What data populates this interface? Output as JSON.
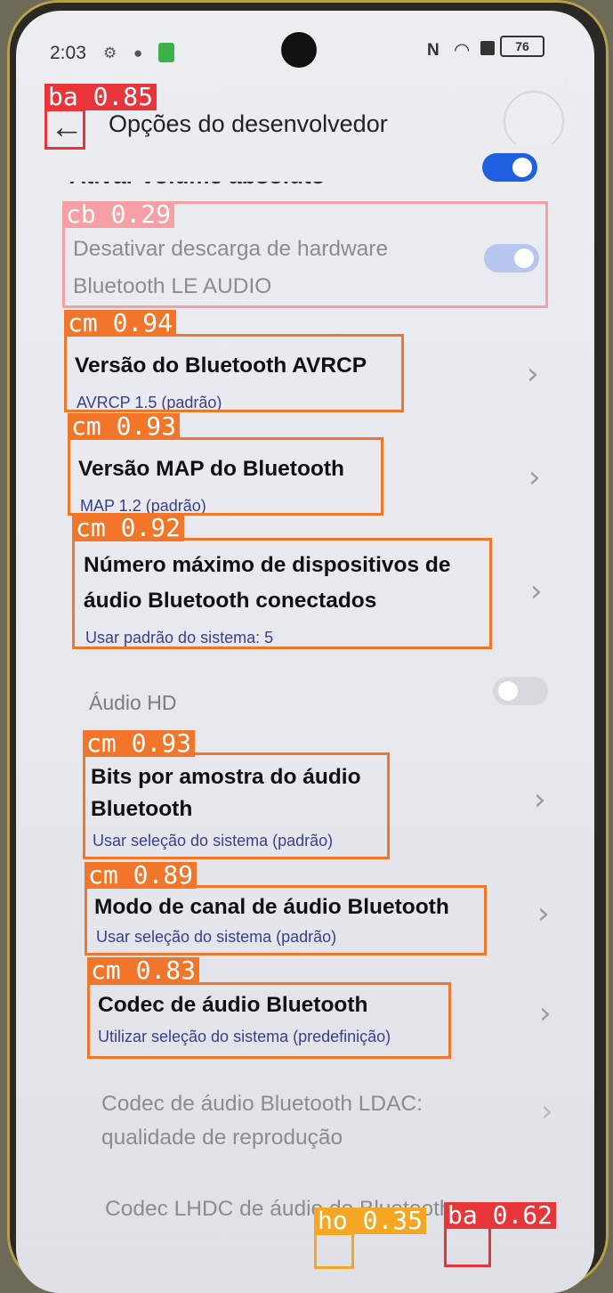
{
  "status_bar": {
    "time": "2:03",
    "battery": "76",
    "nfc_label": "N"
  },
  "header": {
    "title": "Opções do desenvolvedor"
  },
  "settings": {
    "cut_item_title": "Ativar volume absoluto",
    "disable_offload_line1": "Desativar descarga de hardware",
    "disable_offload_line2": "Bluetooth LE AUDIO",
    "avrcp_title": "Versão do Bluetooth AVRCP",
    "avrcp_value": "AVRCP 1.5 (padrão)",
    "map_title": "Versão MAP do Bluetooth",
    "map_value": "MAP 1.2 (padrão)",
    "max_devices_line1": "Número máximo de dispositivos de",
    "max_devices_line2": "áudio Bluetooth conectados",
    "max_devices_value": "Usar padrão do sistema: 5",
    "hd_audio_header": "Áudio HD",
    "bits_line1": "Bits por amostra do áudio",
    "bits_line2": "Bluetooth",
    "bits_value": "Usar seleção do sistema (padrão)",
    "channel_title": "Modo de canal de áudio Bluetooth",
    "channel_value": "Usar seleção do sistema (padrão)",
    "codec_title": "Codec de áudio Bluetooth",
    "codec_value": "Utilizar seleção do sistema (predefinição)",
    "ldac_line1": "Codec de áudio Bluetooth LDAC:",
    "ldac_line2": "qualidade de reprodução",
    "lhdc_line1": "Codec LHDC de áudio do Bluetooth:"
  },
  "toggles": {
    "absolute_volume": "on",
    "le_audio_offload": "on-disabled",
    "hd_audio": "off-disabled"
  },
  "detections": [
    {
      "label": "ba 0.85",
      "color": "#e8353a"
    },
    {
      "label": "cb 0.29",
      "color": "#f4a0a4"
    },
    {
      "label": "cm 0.94",
      "color": "#f2762a"
    },
    {
      "label": "cm 0.93",
      "color": "#f2762a"
    },
    {
      "label": "cm 0.92",
      "color": "#f2762a"
    },
    {
      "label": "cm 0.93",
      "color": "#f2762a"
    },
    {
      "label": "cm 0.89",
      "color": "#f2762a"
    },
    {
      "label": "cm 0.83",
      "color": "#f2762a"
    },
    {
      "label": "ho 0.35",
      "color": "#f5a623"
    },
    {
      "label": "ba 0.62",
      "color": "#e8353a"
    }
  ]
}
